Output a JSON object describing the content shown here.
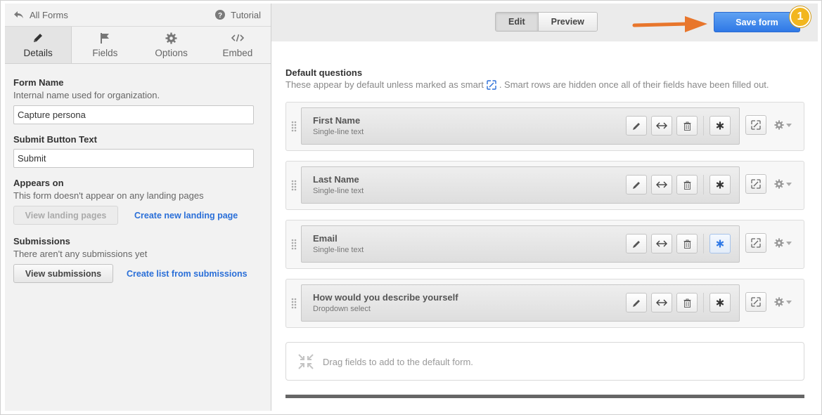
{
  "topbar": {
    "back_label": "All Forms",
    "help_label": "Tutorial"
  },
  "tabs": [
    {
      "label": "Details",
      "icon": "pencil-icon",
      "active": true
    },
    {
      "label": "Fields",
      "icon": "flag-icon",
      "active": false
    },
    {
      "label": "Options",
      "icon": "gear-icon",
      "active": false
    },
    {
      "label": "Embed",
      "icon": "code-icon",
      "active": false
    }
  ],
  "details": {
    "form_name_label": "Form Name",
    "form_name_hint": "Internal name used for organization.",
    "form_name_value": "Capture persona",
    "submit_label": "Submit Button Text",
    "submit_value": "Submit",
    "appears_label": "Appears on",
    "appears_hint": "This form doesn't appear on any landing pages",
    "view_landing_button": "View landing pages",
    "create_landing_link": "Create new landing page",
    "submissions_label": "Submissions",
    "submissions_hint": "There aren't any submissions yet",
    "view_submissions_button": "View submissions",
    "create_list_link": "Create list from submissions"
  },
  "toolbar": {
    "edit_label": "Edit",
    "preview_label": "Preview",
    "save_label": "Save form",
    "badge": "1"
  },
  "default_questions": {
    "title": "Default questions",
    "subtitle_before": "These appear by default unless marked as smart",
    "subtitle_after": ". Smart rows are hidden once all of their fields have been filled out.",
    "fields": [
      {
        "name": "First Name",
        "type": "Single-line text",
        "required_active": false
      },
      {
        "name": "Last Name",
        "type": "Single-line text",
        "required_active": false
      },
      {
        "name": "Email",
        "type": "Single-line text",
        "required_active": true
      },
      {
        "name": "How would you describe yourself",
        "type": "Dropdown select",
        "required_active": false
      }
    ]
  },
  "dropzone": {
    "text": "Drag fields to add to the default form."
  },
  "colors": {
    "accent": "#2f78e6",
    "link": "#2a6fd8",
    "badge": "#f2b61e",
    "arrow": "#e8762c"
  }
}
